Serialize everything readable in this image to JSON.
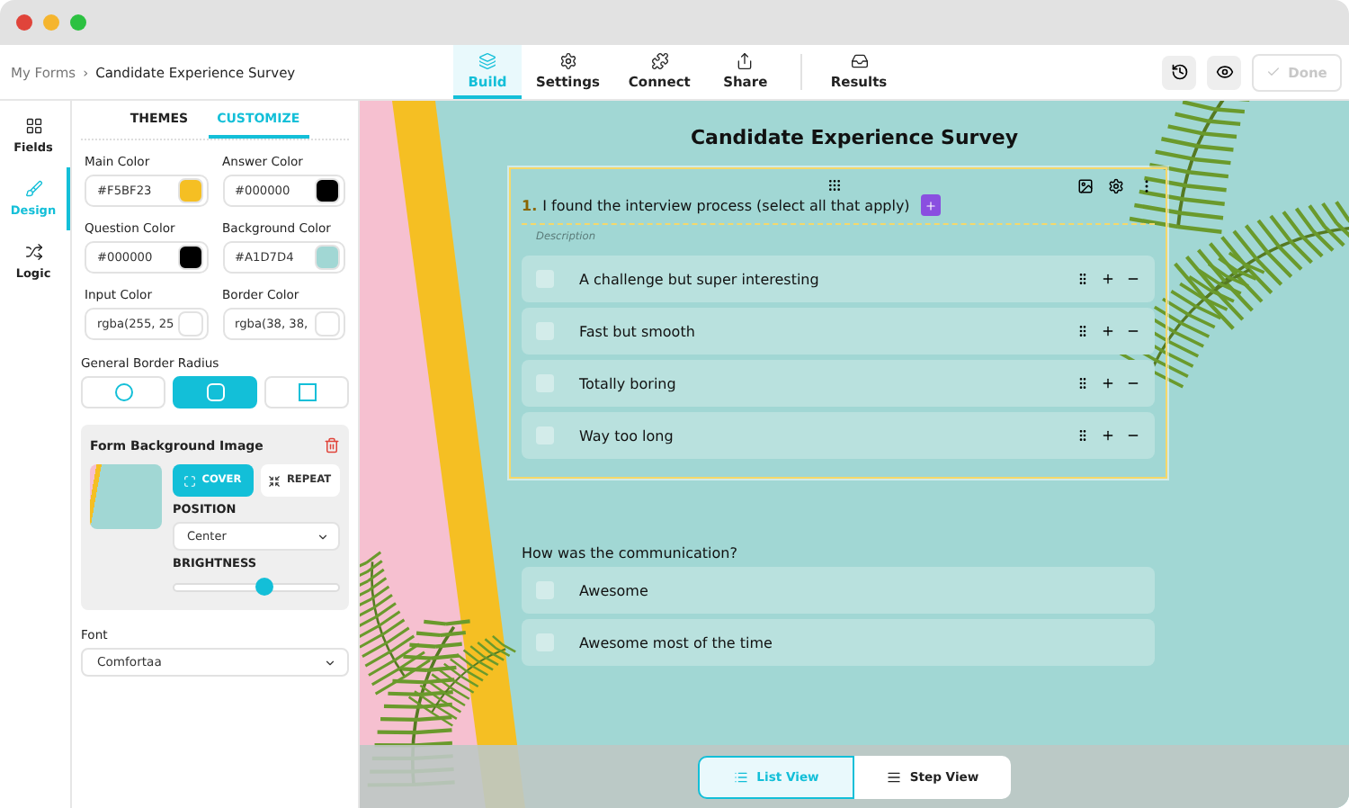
{
  "breadcrumb": [
    {
      "label": "My Forms",
      "kind": "link"
    },
    {
      "label": "›",
      "kind": "separator"
    },
    {
      "label": "Candidate Experience Survey",
      "kind": "current"
    }
  ],
  "nav_tabs": [
    {
      "label": "Build",
      "selected": true
    },
    {
      "label": "Settings",
      "selected": false
    },
    {
      "label": "Connect",
      "selected": false
    },
    {
      "label": "Share",
      "selected": false
    },
    {
      "label": "Results",
      "selected": false
    }
  ],
  "done_button": {
    "label": "Done",
    "disabled": true
  },
  "side_nav": [
    {
      "label": "Fields",
      "selected": false
    },
    {
      "label": "Design",
      "selected": true
    },
    {
      "label": "Logic",
      "selected": false
    }
  ],
  "panel_tabs": [
    {
      "label": "THEMES",
      "selected": false
    },
    {
      "label": "CUSTOMIZE",
      "selected": true
    }
  ],
  "colors": [
    {
      "label": "Main Color",
      "value": "#F5BF23",
      "color": "#f5bf23"
    },
    {
      "label": "Answer Color",
      "value": "#000000",
      "color": "#000000"
    },
    {
      "label": "Question Color",
      "value": "#000000",
      "color": "#000000"
    },
    {
      "label": "Background Color",
      "value": "#A1D7D4",
      "color": "#a1d7d4"
    },
    {
      "label": "Input Color",
      "value": "rgba(255, 25",
      "color": "#ffffff"
    },
    {
      "label": "Border Color",
      "value": "rgba(38, 38,",
      "color": "#ffffff"
    }
  ],
  "border_radius": {
    "label": "General Border Radius",
    "options": [
      {
        "kind": "full",
        "selected": false
      },
      {
        "kind": "medium",
        "selected": true
      },
      {
        "kind": "none",
        "selected": false
      }
    ]
  },
  "background_image": {
    "title": "Form Background Image",
    "modes": [
      {
        "label": "COVER",
        "kind": "cover",
        "selected": true
      },
      {
        "label": "REPEAT",
        "kind": "repeat",
        "selected": false
      }
    ],
    "position_label": "POSITION",
    "position": "Center",
    "brightness_label": "BRIGHTNESS",
    "brightness": {
      "level": 0.55
    }
  },
  "font": {
    "label": "Font",
    "value": "Comfortaa"
  },
  "form": {
    "title": "Candidate Experience Survey",
    "questions": [
      {
        "number": "1.",
        "text": "I found the interview process (select all that apply)",
        "description": "Description",
        "selected": true,
        "options": [
          {
            "label": "A challenge but super interesting",
            "checked": false
          },
          {
            "label": "Fast but smooth",
            "checked": false
          },
          {
            "label": "Totally boring",
            "checked": false
          },
          {
            "label": "Way too long",
            "checked": false
          }
        ]
      },
      {
        "text": "How was the communication?",
        "selected": false,
        "options": [
          {
            "label": "Awesome",
            "checked": false
          },
          {
            "label": "Awesome most of the time",
            "checked": false
          }
        ]
      }
    ]
  },
  "views": [
    {
      "label": "List View",
      "selected": true
    },
    {
      "label": "Step View",
      "selected": false
    }
  ]
}
